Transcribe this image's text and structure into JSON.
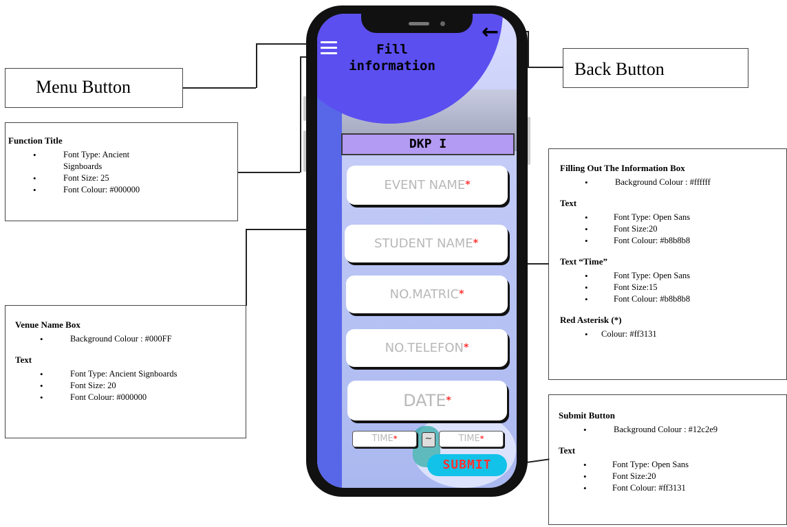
{
  "labels": {
    "menu_button": "Menu Button",
    "back_button": "Back Button"
  },
  "notes": {
    "function_title": {
      "title": "Function Title",
      "items": [
        "Font Type: Ancient Signboards",
        "Font Size: 25",
        "Font Colour: #000000"
      ]
    },
    "venue_name_box": {
      "title": "Venue Name Box",
      "items": [
        "Background Colour : #000FF"
      ],
      "text_title": "Text",
      "text_items": [
        "Font Type: Ancient Signboards",
        "Font Size: 20",
        "Font Colour: #000000"
      ]
    },
    "info_box": {
      "title": "Filling Out The Information Box",
      "items": [
        "Background Colour : #ffffff"
      ],
      "text_title": "Text",
      "text_items": [
        "Font Type: Open Sans",
        "Font Size:20",
        "Font Colour: #b8b8b8"
      ],
      "time_title": "Text “Time”",
      "time_items": [
        "Font Type: Open Sans",
        "Font Size:15",
        "Font Colour: #b8b8b8"
      ],
      "asterisk_title": "Red Asterisk (*)",
      "asterisk_items": [
        "Colour: #ff3131"
      ]
    },
    "submit_button": {
      "title": "Submit Button",
      "items": [
        "Background Colour : #12c2e9"
      ],
      "text_title": "Text",
      "text_items": [
        "Font Type: Open Sans",
        "Font Size:20",
        "Font Colour: #ff3131"
      ]
    }
  },
  "phone": {
    "title_line1": "Fill",
    "title_line2": "information",
    "venue": "DKP I",
    "fields": {
      "event_name": "EVENT NAME",
      "student_name": "STUDENT NAME",
      "matric": "NO.MATRIC",
      "telefon": "NO.TELEFON",
      "date": "DATE",
      "time_start": "TIME",
      "time_end": "TIME"
    },
    "asterisk": "*",
    "tilde": "~",
    "submit": "SUBMIT",
    "back_icon": "←"
  },
  "colors": {
    "asterisk": "#ff3131",
    "submit_bg": "#12c2e9",
    "placeholder_text": "#b8b8b8",
    "venue_bg": "#b39af2",
    "header_circle": "#5b4ff0"
  },
  "icons": [
    "menu-icon",
    "back-arrow-icon"
  ]
}
